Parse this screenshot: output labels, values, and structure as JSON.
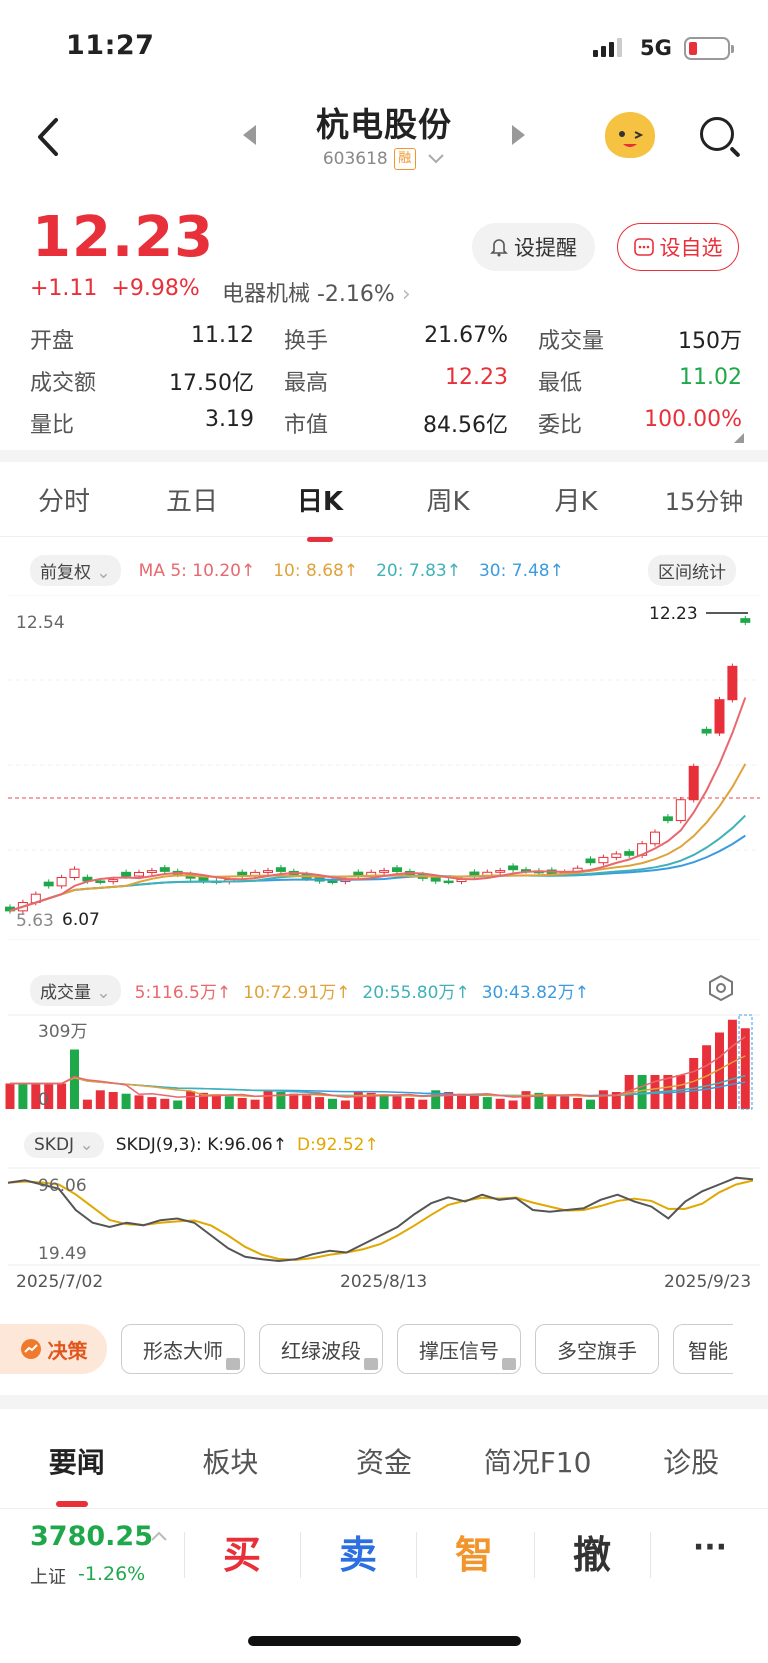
{
  "status": {
    "time": "11:27",
    "network": "5G"
  },
  "header": {
    "title": "杭电股份",
    "code": "603618",
    "rong_badge": "融"
  },
  "quote": {
    "price": "12.23",
    "change": "+1.11",
    "change_pct": "+9.98%",
    "sector": "电器机械 -2.16%",
    "alert_label": "设提醒",
    "watch_label": "设自选"
  },
  "stats": [
    [
      {
        "k": "开盘",
        "v": "11.12"
      },
      {
        "k": "换手",
        "v": "21.67%"
      },
      {
        "k": "成交量",
        "v": "150万"
      }
    ],
    [
      {
        "k": "成交额",
        "v": "17.50亿"
      },
      {
        "k": "最高",
        "v": "12.23"
      },
      {
        "k": "最低",
        "v": "11.02"
      }
    ],
    [
      {
        "k": "量比",
        "v": "3.19"
      },
      {
        "k": "市值",
        "v": "84.56亿"
      },
      {
        "k": "委比",
        "v": "100.00%"
      }
    ]
  ],
  "ktabs": [
    "分时",
    "五日",
    "日K",
    "周K",
    "月K",
    "15分钟"
  ],
  "ktab_active": "日K",
  "ma": {
    "adjust": "前复权",
    "ma5": "MA 5: 10.20",
    "ma10": "10: 8.68",
    "ma20": "20: 7.83",
    "ma30": "30: 7.48",
    "range_stat": "区间统计"
  },
  "price_chart": {
    "high_label": "12.54",
    "last_label": "12.23",
    "low_label": "5.63",
    "low2_label": "6.07"
  },
  "volume": {
    "label": "成交量",
    "v5": "5:116.5万",
    "v10": "10:72.91万",
    "v20": "20:55.80万",
    "v30": "30:43.82万",
    "max_label": "309万",
    "zero_label": "0"
  },
  "skdj": {
    "label": "SKDJ",
    "params": "SKDJ(9,3):",
    "k": "K:96.06",
    "d": "D:92.52",
    "top_label": "96.06",
    "bottom_label": "19.49"
  },
  "dates": [
    "2025/7/02",
    "2025/8/13",
    "2025/9/23"
  ],
  "tools": [
    "决策",
    "形态大师",
    "红绿波段",
    "撑压信号",
    "多空旗手",
    "智能"
  ],
  "news_tabs": [
    "要闻",
    "板块",
    "资金",
    "简况F10",
    "诊股"
  ],
  "news_tab_active": "要闻",
  "index": {
    "value": "3780.25",
    "name": "上证",
    "change": "-1.26%"
  },
  "actions": [
    "买",
    "卖",
    "智",
    "撤",
    "···"
  ],
  "colors": {
    "up": "#e8303a",
    "down": "#1fa84a",
    "ma5": "#e8686d",
    "ma10": "#e0a23a",
    "ma20": "#3fb2b8",
    "ma30": "#3b9be0"
  }
}
